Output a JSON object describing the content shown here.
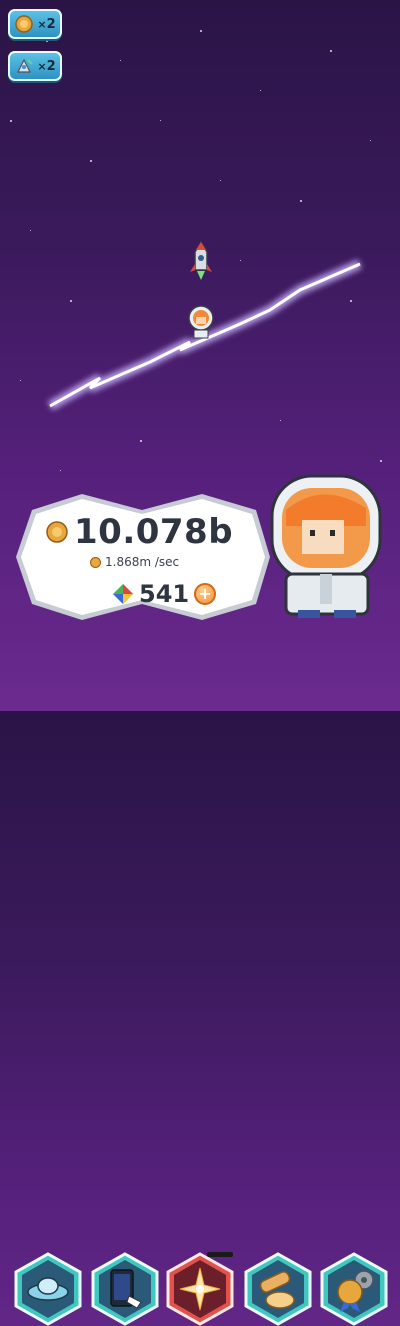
{
  "boosts": [
    {
      "icon": "coin-boost-icon",
      "multiplier": "2",
      "prefix": "×"
    },
    {
      "icon": "rocket-boost-icon",
      "multiplier": "2",
      "prefix": "×"
    }
  ],
  "stats": {
    "coins": "10.078b",
    "rate": "1.868m /sec",
    "gems": "541"
  },
  "nav": [
    {
      "icon": "ufo-icon",
      "active": false
    },
    {
      "icon": "phone-icon",
      "active": false
    },
    {
      "icon": "star-burst-icon",
      "active": true
    },
    {
      "icon": "telescope-icon",
      "active": false
    },
    {
      "icon": "medal-gear-icon",
      "active": false
    }
  ],
  "colors": {
    "background_top": "#2a1446",
    "background_bottom": "#6b2a8f",
    "nav_active": "#e0524a",
    "nav_normal": "#3fc7c0",
    "boost": "#3aa5d4"
  }
}
